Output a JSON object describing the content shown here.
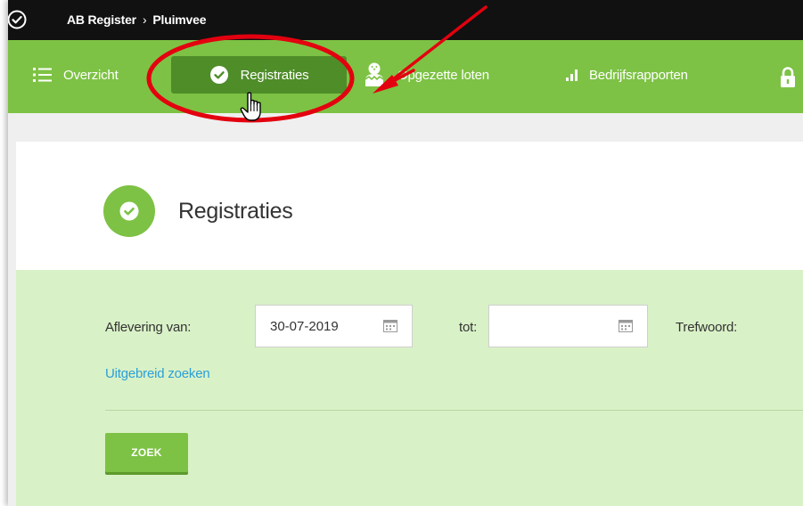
{
  "topbar": {
    "breadcrumb": {
      "app": "AB Register",
      "separator": "›",
      "section": "Pluimvee"
    },
    "logo_icon": "check-circle-icon"
  },
  "nav": {
    "items": [
      {
        "label": "Overzicht",
        "icon": "list-icon",
        "active": false
      },
      {
        "label": "Registraties",
        "icon": "check-circle-icon",
        "active": true
      },
      {
        "label": "Opgezette loten",
        "icon": "chick-icon",
        "active": false
      },
      {
        "label": "Bedrijfsrapporten",
        "icon": "signal-bars-icon",
        "active": false
      }
    ],
    "trailing_icon": "lock-icon"
  },
  "page": {
    "title": "Registraties",
    "icon": "check-circle-icon"
  },
  "search": {
    "aflevering_label": "Aflevering van:",
    "aflevering_van_value": "30-07-2019",
    "tot_label": "tot:",
    "tot_value": "",
    "trefwoord_label": "Trefwoord:",
    "advanced_link": "Uitgebreid zoeken",
    "submit_label": "ZOEK"
  },
  "colors": {
    "topbar": "#111111",
    "nav_green": "#7dc244",
    "nav_active": "#4f8d29",
    "filter_bg": "#d9f1c7",
    "link": "#2b9fd8",
    "annotation_red": "#e3000f"
  }
}
